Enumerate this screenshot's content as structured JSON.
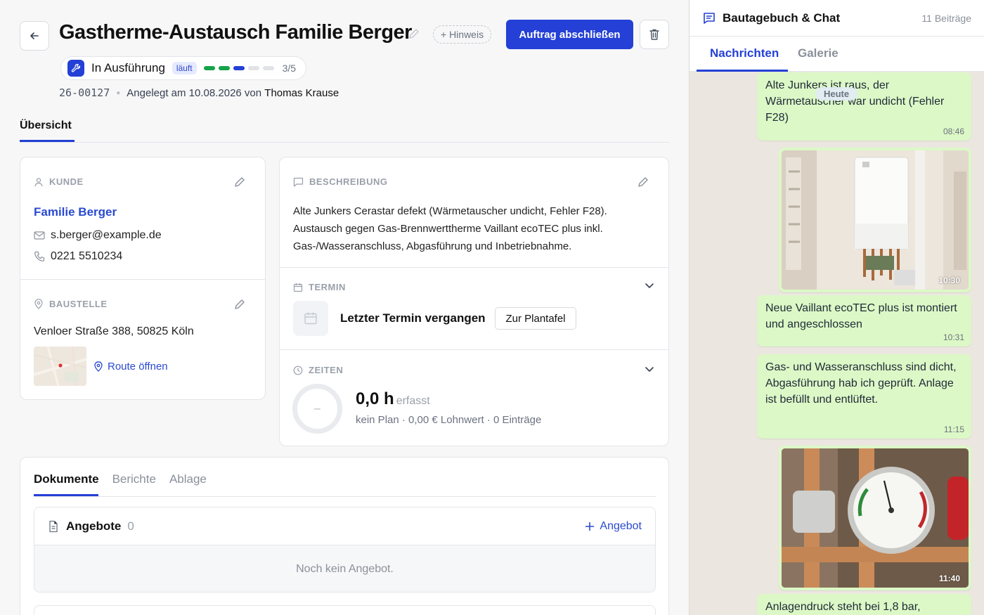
{
  "header": {
    "title": "Gastherme-Austausch Familie Berger",
    "hint_label": "+ Hinweis",
    "complete_label": "Auftrag abschließen",
    "status": {
      "label": "In Ausführung",
      "badge": "läuft",
      "progress_done": 2,
      "progress_current": 3,
      "progress_total": 5,
      "progress_text": "3/5"
    },
    "meta": {
      "number": "26-00127",
      "created": "Angelegt am 10.08.2026 von",
      "user": "Thomas Krause"
    }
  },
  "tabs": {
    "overview": "Übersicht"
  },
  "kunde": {
    "heading": "KUNDE",
    "name": "Familie Berger",
    "email": "s.berger@example.de",
    "phone": "0221 5510234"
  },
  "baustelle": {
    "heading": "BAUSTELLE",
    "address": "Venloer Straße 388, 50825 Köln",
    "route_label": "Route öffnen"
  },
  "beschreibung": {
    "heading": "BESCHREIBUNG",
    "text": "Alte Junkers Cerastar defekt (Wärmetauscher undicht, Fehler F28). Austausch gegen Gas-Brennwerttherme Vaillant ecoTEC plus inkl. Gas-/Wasseranschluss, Abgasführung und Inbetriebnahme."
  },
  "termin": {
    "heading": "TERMIN",
    "status": "Letzter Termin vergangen",
    "button": "Zur Plantafel"
  },
  "zeiten": {
    "heading": "ZEITEN",
    "ring_placeholder": "–",
    "hours": "0,0 h",
    "hours_suffix": "erfasst",
    "summary": "kein Plan · 0,00 € Lohnwert · 0 Einträge"
  },
  "documents": {
    "tabs": [
      "Dokumente",
      "Berichte",
      "Ablage"
    ],
    "angebote": {
      "title": "Angebote",
      "count": "0",
      "add_label": "Angebot",
      "empty": "Noch kein Angebot."
    }
  },
  "chat": {
    "title": "Bautagebuch & Chat",
    "count": "11 Beiträge",
    "tabs": [
      "Nachrichten",
      "Galerie"
    ],
    "day_chip": "Heute",
    "messages": [
      {
        "text": "Alte Junkers ist raus, der Wärmetauscher war undicht (Fehler F28)",
        "time": "08:46"
      },
      {
        "image": "Neue Gastherme an der Wand",
        "time": "10:30"
      },
      {
        "text": "Neue Vaillant ecoTEC plus ist montiert und angeschlossen",
        "time": "10:31"
      },
      {
        "text": "Gas- und Wasseranschluss sind dicht, Abgasführung hab ich geprüft. Anlage ist befüllt und entlüftet.",
        "time": "11:15"
      },
      {
        "image": "Manometer der Anlage",
        "time": "11:40"
      },
      {
        "text": "Anlagendruck steht bei 1,8 bar,"
      }
    ]
  },
  "colors": {
    "accent": "#2440d6",
    "progress_done": "#16a34a",
    "bubble": "#dcf8c6",
    "chat_bg": "#ebe7e0"
  }
}
